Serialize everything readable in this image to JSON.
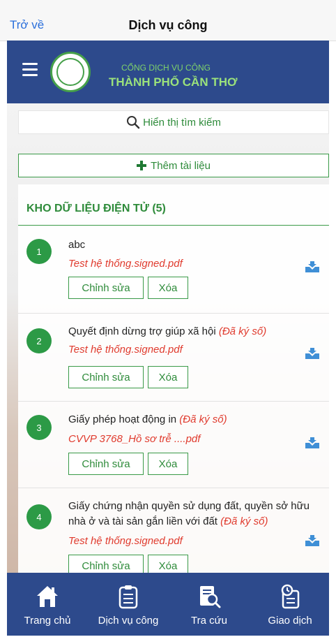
{
  "nav": {
    "back_label": "Trở về",
    "title": "Dịch vụ công"
  },
  "header": {
    "line1": "CỔNG DỊCH VỤ CÔNG",
    "line2": "THÀNH PHỐ CẦN THƠ"
  },
  "search": {
    "label": "Hiển thị tìm kiếm"
  },
  "add": {
    "label": "Thêm tài liệu"
  },
  "panel": {
    "title": "KHO DỮ LIỆU ĐIỆN TỬ (5)"
  },
  "items": [
    {
      "num": "1",
      "name": "abc",
      "signed": "",
      "file": "Test hệ thống.signed.pdf"
    },
    {
      "num": "2",
      "name": "Quyết định dừng trợ giúp xã hội",
      "signed": "(Đã ký số)",
      "file": "Test hệ thống.signed.pdf"
    },
    {
      "num": "3",
      "name": "Giấy phép hoạt động in",
      "signed": "(Đã ký số)",
      "file": "CVVP 3768_Hồ sơ trễ ....pdf"
    },
    {
      "num": "4",
      "name": "Giấy chứng nhận quyền sử dụng đất, quyền sở hữu nhà ở và tài sản gắn liền với đất",
      "signed": "(Đã ký số)",
      "file": "Test hệ thống.signed.pdf"
    }
  ],
  "buttons": {
    "edit": "Chỉnh sửa",
    "delete": "Xóa"
  },
  "tabs": [
    {
      "label": "Trang chủ",
      "icon": "home-icon"
    },
    {
      "label": "Dịch vụ công",
      "icon": "clipboard-icon"
    },
    {
      "label": "Tra cứu",
      "icon": "document-search-icon"
    },
    {
      "label": "Giao dịch",
      "icon": "transaction-icon"
    }
  ],
  "colors": {
    "header_bg": "#2d4a8c",
    "accent_green": "#2e8b3a",
    "signed_red": "#e03b2e"
  }
}
